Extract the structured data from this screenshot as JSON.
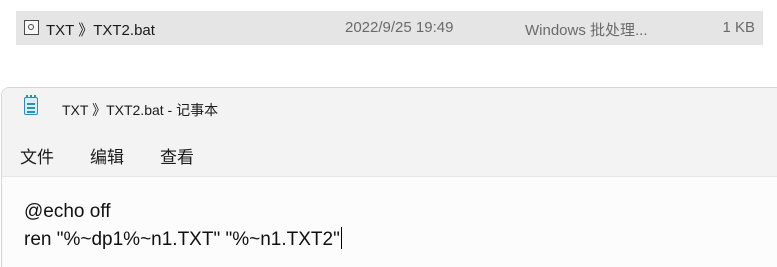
{
  "explorer": {
    "file": {
      "name": "TXT 》TXT2.bat",
      "date": "2022/9/25 19:49",
      "type": "Windows 批处理...",
      "size": "1 KB",
      "icon": "batch-file-icon"
    }
  },
  "notepad": {
    "title": "TXT 》TXT2.bat - 记事本",
    "icon": "notepad-icon",
    "menu": {
      "file": "文件",
      "edit": "编辑",
      "view": "查看"
    },
    "content": {
      "lines": [
        "@echo off",
        "ren \"%~dp1%~n1.TXT\" \"%~n1.TXT2\""
      ]
    }
  }
}
